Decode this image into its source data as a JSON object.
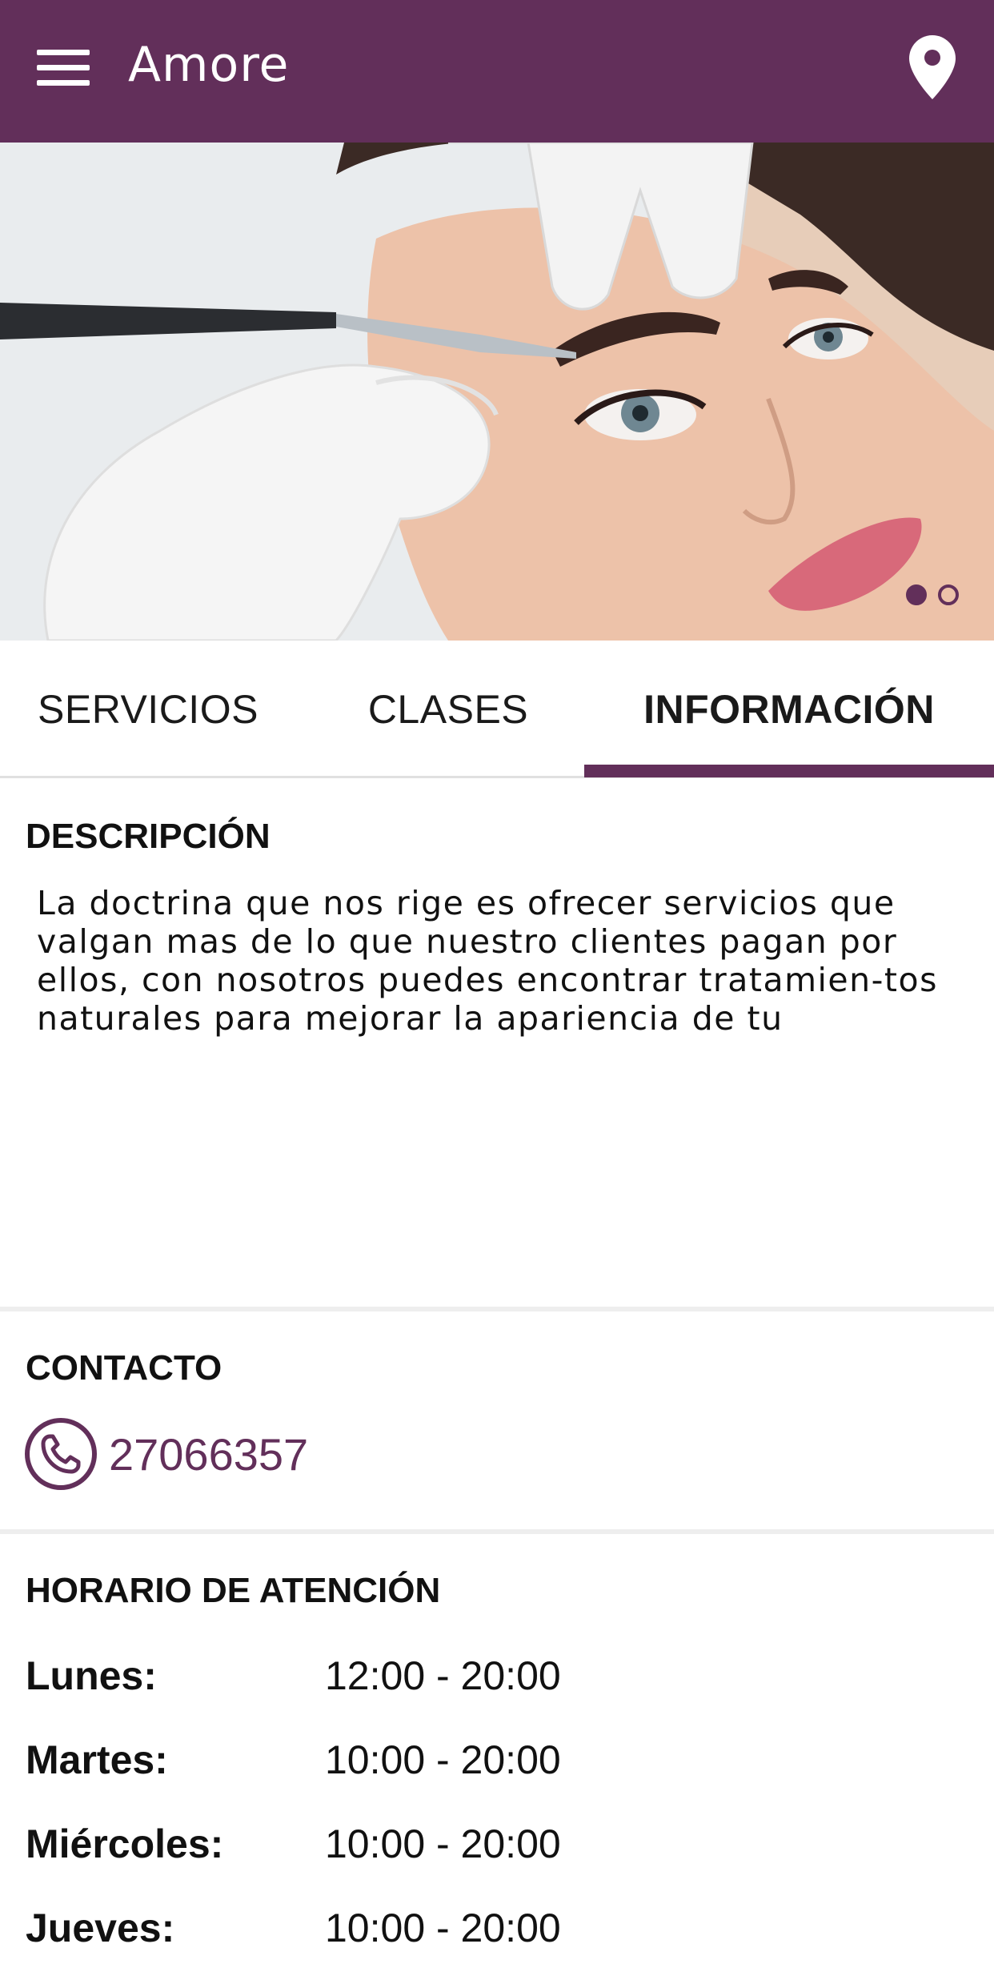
{
  "header": {
    "title": "Amore",
    "menu_icon": "hamburger-menu-icon",
    "location_icon": "map-pin-icon"
  },
  "carousel": {
    "image_alt": "Tratamiento de cejas",
    "slides": 2,
    "active_slide": 1
  },
  "tabs": [
    {
      "label": "SERVICIOS",
      "active": false
    },
    {
      "label": "CLASES",
      "active": false
    },
    {
      "label": "INFORMACIÓN",
      "active": true
    }
  ],
  "description": {
    "title": "DESCRIPCIÓN",
    "text": "La doctrina que nos rige es ofrecer servicios que valgan mas de lo que nuestro clientes pagan por ellos, con nosotros puedes encontrar tratamien-tos naturales para mejorar la apariencia de tu"
  },
  "contact": {
    "title": "CONTACTO",
    "phone": "27066357",
    "phone_icon": "phone-icon"
  },
  "hours": {
    "title": "HORARIO DE ATENCIÓN",
    "rows": [
      {
        "day": "Lunes:",
        "time": "12:00 - 20:00"
      },
      {
        "day": "Martes:",
        "time": "10:00 - 20:00"
      },
      {
        "day": "Miércoles:",
        "time": "10:00 - 20:00"
      },
      {
        "day": "Jueves:",
        "time": "10:00 - 20:00"
      }
    ]
  },
  "colors": {
    "brand": "#622f5a",
    "divider": "#eeeeee"
  }
}
